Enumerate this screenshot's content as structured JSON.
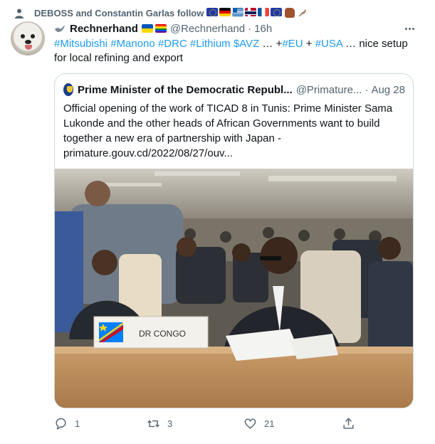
{
  "social_context": {
    "text": "DEBOSS and Constantin Garlas  follow",
    "icon": "person-icon",
    "flags": [
      "eu",
      "de",
      "gr",
      "no",
      "fr",
      "eu"
    ]
  },
  "tweet": {
    "display_name": "Rechnerhand",
    "handle": "@Rechnerhand",
    "separator": "·",
    "time": "16h",
    "text_parts": [
      {
        "text": "#Mitsubishi",
        "tag": true
      },
      {
        "text": " ",
        "tag": false
      },
      {
        "text": "#Manono",
        "tag": true
      },
      {
        "text": " ",
        "tag": false
      },
      {
        "text": "#DRC",
        "tag": true
      },
      {
        "text": " ",
        "tag": false
      },
      {
        "text": "#Lithium",
        "tag": true
      },
      {
        "text": " ",
        "tag": false
      },
      {
        "text": "$AVZ",
        "tag": true
      },
      {
        "text": " … +",
        "tag": false
      },
      {
        "text": "#EU",
        "tag": true
      },
      {
        "text": " + ",
        "tag": false
      },
      {
        "text": "#USA",
        "tag": true
      },
      {
        "text": " … nice setup for local refining and export",
        "tag": false
      }
    ]
  },
  "quote": {
    "name": "Prime Minister of the Democratic Republ...",
    "handle": "@Primature...",
    "separator": "·",
    "time": "Aug 28",
    "text": "Official opening of the work of TICAD 8 in Tunis: Prime Minister Sama Lukonde and the other heads of African Governments want to build together a new era of partnership with Japan - primature.gouv.cd/2022/08/27/ouv...",
    "photo": {
      "nameplate": "DR CONGO"
    }
  },
  "actions": {
    "reply_count": "1",
    "retweet_count": "3",
    "like_count": "21"
  },
  "colors": {
    "link": "#1d9bf0",
    "secondary": "#536471",
    "border": "#cfd9de"
  }
}
